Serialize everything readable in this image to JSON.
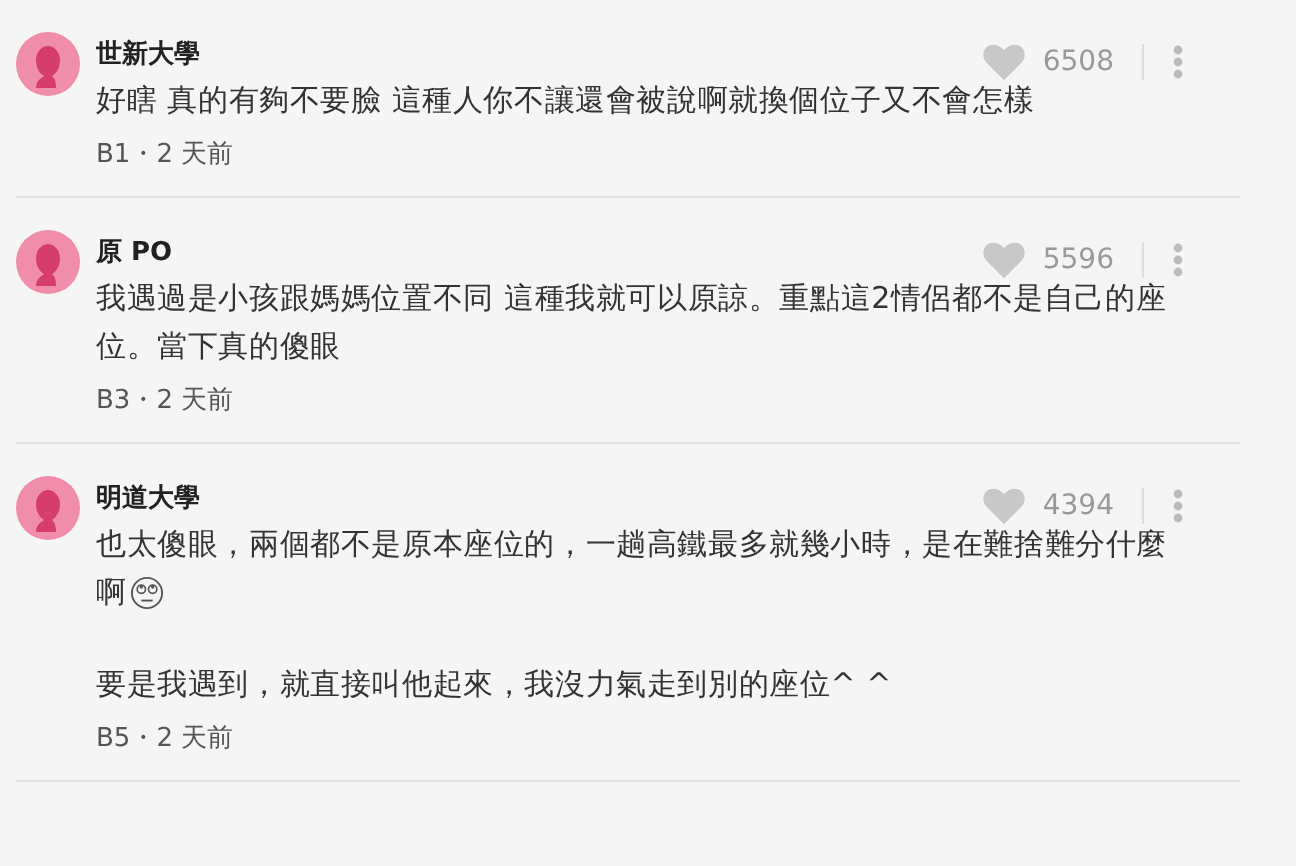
{
  "comments": [
    {
      "author": "世新大學",
      "likes": "6508",
      "meta": "B1・2 天前",
      "paragraphs": [
        {
          "lines": [
            "好瞎 真的有夠不要臉 這種人你不讓還會被說啊就換個位子又不會怎樣"
          ],
          "emoji": false
        }
      ]
    },
    {
      "author": "原 PO",
      "likes": "5596",
      "meta": "B3・2 天前",
      "paragraphs": [
        {
          "lines": [
            "我遇過是小孩跟媽媽位置不同 這種我就可以原諒。重點這2情侶都不是自己的座",
            "位。當下真的傻眼"
          ],
          "emoji": false
        }
      ]
    },
    {
      "author": "明道大學",
      "likes": "4394",
      "meta": "B5・2 天前",
      "paragraphs": [
        {
          "lines": [
            "也太傻眼，兩個都不是原本座位的，一趟高鐵最多就幾小時，是在難捨難分什麼",
            "啊"
          ],
          "emoji": true
        },
        {
          "lines": [
            "要是我遇到，就直接叫他起來，我沒力氣走到別的座位^ ^"
          ],
          "emoji": false
        }
      ]
    }
  ]
}
